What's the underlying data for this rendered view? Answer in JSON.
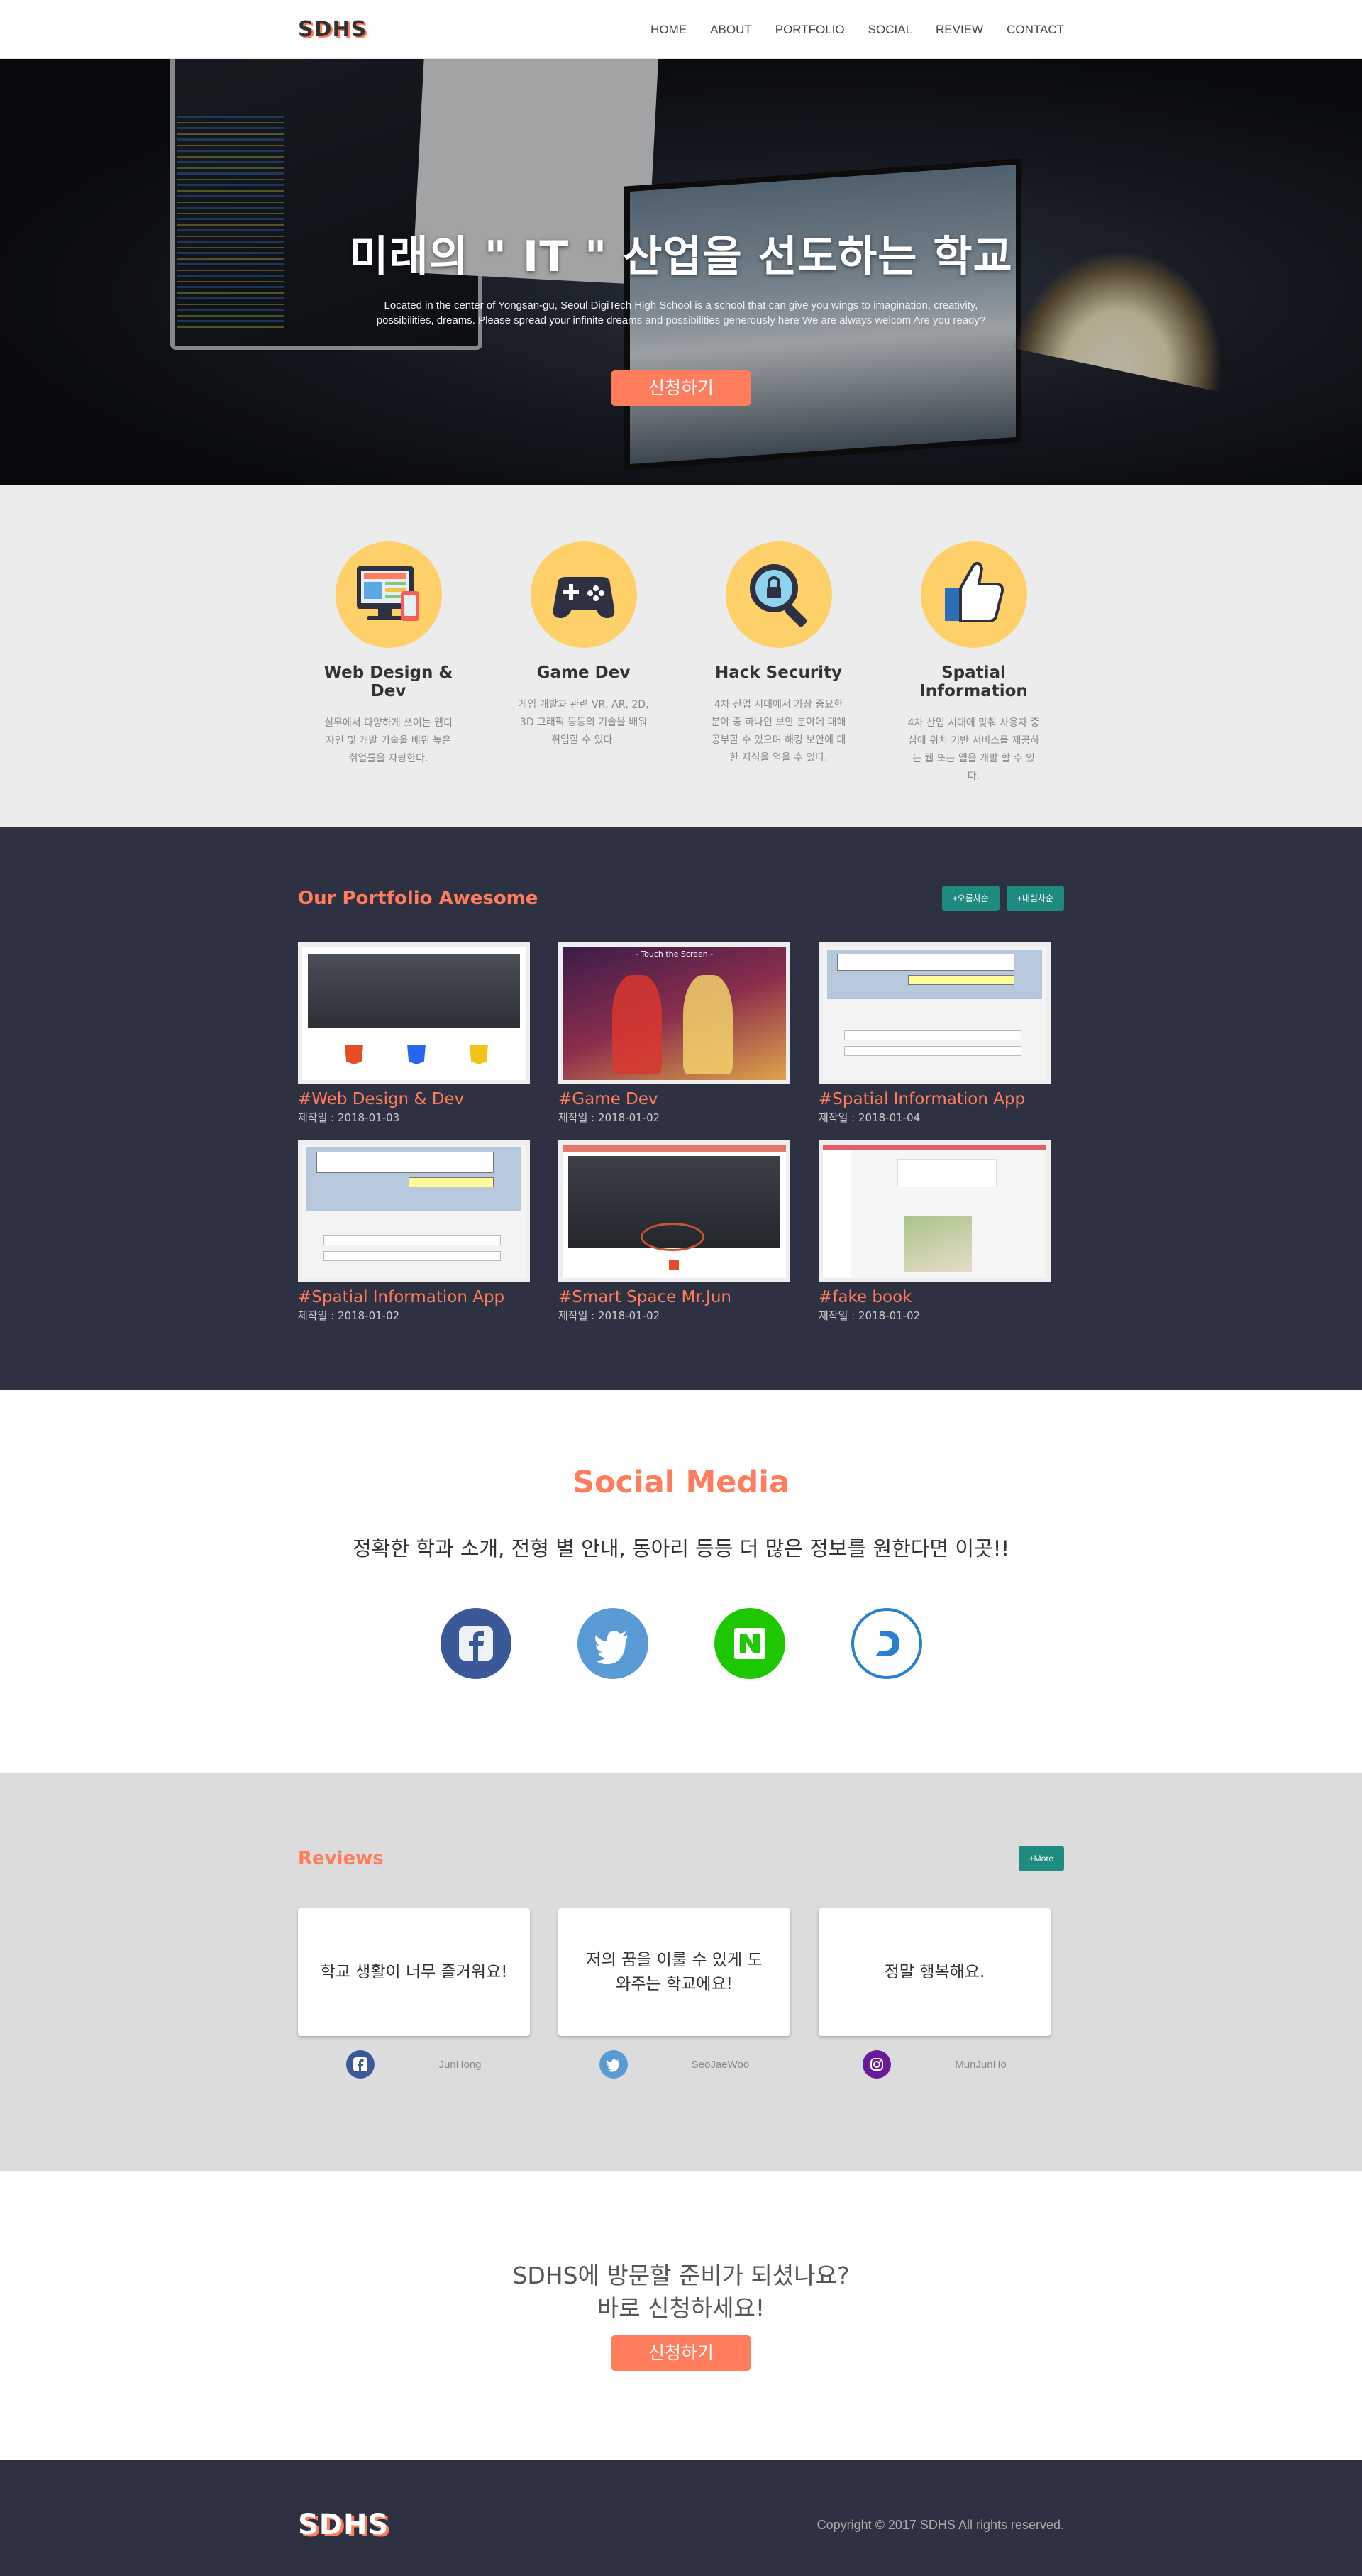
{
  "nav": {
    "logo": "SDHS",
    "items": [
      "HOME",
      "ABOUT",
      "PORTFOLIO",
      "SOCIAL",
      "REVIEW",
      "CONTACT"
    ]
  },
  "hero": {
    "title": "미래의 \" IT \" 산업을 선도하는 학교",
    "subtitle": "Located in the center of Yongsan-gu, Seoul DigiTech High School is a school that can give you wings to imagination, creativity, possibilities, dreams. Please spread your infinite dreams and possibilities generously here We are always welcom Are you ready?",
    "button": "신청하기"
  },
  "features": [
    {
      "icon": "web-design-icon",
      "title": "Web Design & Dev",
      "desc": "실무에서 다양하게 쓰이는 웹디자인 및 개발 기술을 배워 높은 취업률을 자랑한다."
    },
    {
      "icon": "gamepad-icon",
      "title": "Game Dev",
      "desc": "게임 개발과 관련 VR, AR, 2D, 3D 그래픽 등등의 기술을 배워 취업할 수 있다."
    },
    {
      "icon": "security-search-icon",
      "title": "Hack Security",
      "desc": "4차 산업 시대에서 가장 중요한 분야 중 하나인 보안 분야에 대해 공부할 수 있으며 해킹 보안에 대한 지식을 얻을 수 있다."
    },
    {
      "icon": "thumbs-up-icon",
      "title": "Spatial Information",
      "desc": "4차 산업 시대에 맞춰 사용자 중심에 위치 기반 서비스를 제공하는 웹 또는 앱을 개발 할 수 있다."
    }
  ],
  "portfolio": {
    "title": "Our Portfolio Awesome",
    "sort_asc": "+오름차순",
    "sort_desc": "+내림차순",
    "items": [
      {
        "title": "#Web Design & Dev",
        "date": "제작일 : 2018-01-03"
      },
      {
        "title": "#Game Dev",
        "date": "제작일 : 2018-01-02"
      },
      {
        "title": "#Spatial Information App",
        "date": "제작일 : 2018-01-04"
      },
      {
        "title": "#Spatial Information App",
        "date": "제작일 : 2018-01-02"
      },
      {
        "title": "#Smart Space Mr.Jun",
        "date": "제작일 : 2018-01-02"
      },
      {
        "title": "#fake book",
        "date": "제작일 : 2018-01-02"
      }
    ],
    "thumb_game_caption": "- Touch the Screen -"
  },
  "social": {
    "title": "Social Media",
    "subtitle": "정확한 학과 소개, 전형 별 안내, 동아리 등등 더 많은 정보를 원한다면 이곳!!",
    "icons": [
      "facebook-icon",
      "twitter-icon",
      "naver-icon",
      "daum-icon"
    ]
  },
  "reviews": {
    "title": "Reviews",
    "more": "+More",
    "items": [
      {
        "text": "학교 생활이 너무 즐거워요!",
        "author": "JunHong",
        "icon": "facebook-icon"
      },
      {
        "text": "저의 꿈을 이룰 수 있게 도와주는 학교에요!",
        "author": "SeoJaeWoo",
        "icon": "twitter-icon"
      },
      {
        "text": "정말 행복해요.",
        "author": "MunJunHo",
        "icon": "instagram-icon"
      }
    ]
  },
  "cta": {
    "line1": "SDHS에 방문할 준비가 되셨나요?",
    "line2": "바로 신청하세요!",
    "button": "신청하기"
  },
  "footer": {
    "logo": "SDHS",
    "copyright": "Copyright © 2017 SDHS All rights reserved."
  },
  "colors": {
    "accent": "#ff7c5c",
    "dark": "#2d3142",
    "teal": "#1f8a80",
    "yellow": "#fdd06a"
  }
}
